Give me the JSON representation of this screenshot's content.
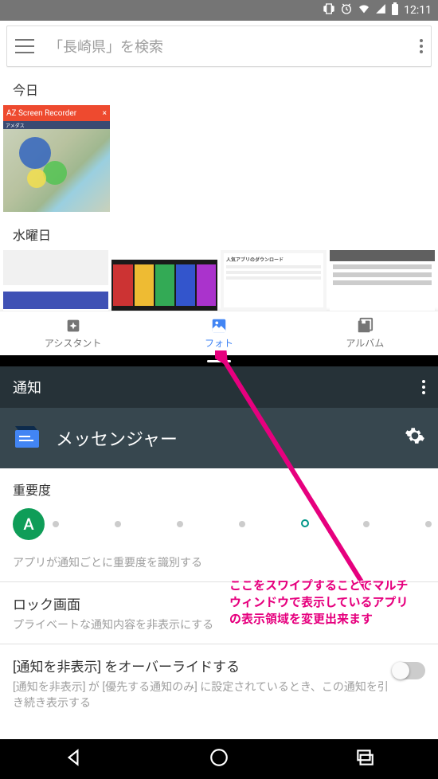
{
  "status": {
    "time": "12:11"
  },
  "search": {
    "placeholder": "「長崎県」を検索"
  },
  "sections": {
    "today": "今日",
    "wednesday": "水曜日"
  },
  "az_recorder": {
    "title": "AZ Screen Recorder",
    "sub": "アメダス"
  },
  "wed_thumbs": {
    "t3_title": "人気アプリのダウンロード"
  },
  "nav": {
    "assistant": "アシスタント",
    "photos": "フォト",
    "albums": "アルバム"
  },
  "settings": {
    "bar_title": "通知",
    "app_name": "メッセンジャー",
    "importance": {
      "title": "重要度",
      "avatar": "A",
      "desc": "アプリが通知ごとに重要度を識別する"
    },
    "lock": {
      "title": "ロック画面",
      "sub": "プライベートな通知内容を非表示にする"
    },
    "override": {
      "title": "[通知を非表示] をオーバーライドする",
      "sub": "[通知を非表示] が [優先する通知のみ] に設定されているとき、この通知を引き続き表示する"
    }
  },
  "annotation": {
    "line1": "ここをスワイプすることでマルチ",
    "line2": "ウィンドウで表示しているアプリ",
    "line3": "の表示領域を変更出来ます"
  }
}
